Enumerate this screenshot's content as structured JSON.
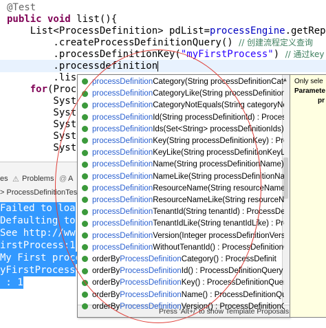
{
  "editor": {
    "lines": [
      {
        "parts": [
          {
            "t": "@Test",
            "c": "ann"
          }
        ]
      },
      {
        "parts": [
          {
            "t": "public void ",
            "c": "kw"
          },
          {
            "t": "list(){",
            "c": "fn"
          }
        ]
      },
      {
        "parts": [
          {
            "t": "    List<ProcessDefinition> pdList=",
            "c": "fn"
          },
          {
            "t": "processEngine",
            "c": "field"
          },
          {
            "t": ".getRepos",
            "c": "fn"
          }
        ]
      },
      {
        "parts": [
          {
            "t": "        .createProcessDefinitionQuery() ",
            "c": "fn"
          },
          {
            "t": "// 创建流程定义查询",
            "c": "cmt"
          }
        ]
      },
      {
        "parts": [
          {
            "t": "        .processDefinitionKey(",
            "c": "fn"
          },
          {
            "t": "\"myFirstProcess\"",
            "c": "str"
          },
          {
            "t": ") ",
            "c": "fn"
          },
          {
            "t": "// 通过key",
            "c": "cmt"
          }
        ]
      },
      {
        "parts": [
          {
            "t": "        .processdefinition",
            "c": "fn"
          }
        ]
      },
      {
        "parts": [
          {
            "t": "        .lis",
            "c": "fn"
          }
        ]
      },
      {
        "parts": [
          {
            "t": "    ",
            "c": "fn"
          },
          {
            "t": "for",
            "c": "kw"
          },
          {
            "t": "(Proc",
            "c": "fn"
          }
        ]
      },
      {
        "parts": [
          {
            "t": "        Syst",
            "c": "fn"
          }
        ]
      },
      {
        "parts": [
          {
            "t": "        Syst",
            "c": "fn"
          }
        ]
      },
      {
        "parts": [
          {
            "t": "        Syst",
            "c": "fn"
          }
        ]
      },
      {
        "parts": [
          {
            "t": "        Syst",
            "c": "fn"
          }
        ]
      },
      {
        "parts": [
          {
            "t": "        Syst",
            "c": "fn"
          }
        ]
      }
    ]
  },
  "bottom_panel": {
    "tabs": [
      "es",
      "Problems",
      "A"
    ],
    "test_label": "> ProcessDefinitionTes",
    "console_lines": [
      "Failed to loa",
      "Defaulting to",
      "See http://ww",
      "irstProcess:1",
      "My First proce",
      "yFirstProcess",
      " : 1"
    ]
  },
  "popup": {
    "items": [
      {
        "hl": "processDefinition",
        "rest": "Category(String processDefinitionCatego",
        "static": false
      },
      {
        "hl": "processDefinition",
        "rest": "CategoryLike(String processDefinitionCa",
        "static": false
      },
      {
        "hl": "processDefinition",
        "rest": "CategoryNotEquals(String categoryNotE",
        "static": false
      },
      {
        "hl": "processDefinition",
        "rest": "Id(String processDefinitionId) : Process",
        "static": false
      },
      {
        "hl": "processDefinition",
        "rest": "Ids(Set<String> processDefinitionIds) : P",
        "static": false
      },
      {
        "hl": "processDefinition",
        "rest": "Key(String processDefinitionKey) : Proce",
        "static": false
      },
      {
        "hl": "processDefinition",
        "rest": "KeyLike(String processDefinitionKeyLike)",
        "static": false
      },
      {
        "hl": "processDefinition",
        "rest": "Name(String processDefinitionName) : P",
        "static": false
      },
      {
        "hl": "processDefinition",
        "rest": "NameLike(String processDefinitionNameL",
        "static": false
      },
      {
        "hl": "processDefinition",
        "rest": "ResourceName(String resourceName) : P",
        "static": false
      },
      {
        "hl": "processDefinition",
        "rest": "ResourceNameLike(String resourceNameLik",
        "static": false
      },
      {
        "hl": "processDefinition",
        "rest": "TenantId(String tenantId) : ProcessDefin",
        "static": false
      },
      {
        "hl": "processDefinition",
        "rest": "TenantIdLike(String tenantIdLike) : Proce",
        "static": false
      },
      {
        "hl": "processDefinition",
        "rest": "Version(Integer processDefinitionVersio",
        "static": false
      },
      {
        "hl": "processDefinition",
        "rest": "WithoutTenantId() : ProcessDefinitionQu",
        "static": false
      },
      {
        "pre": "orderBy",
        "hl": "ProcessDefinition",
        "rest": "Category() : ProcessDefinit",
        "static": false
      },
      {
        "pre": "orderBy",
        "hl": "ProcessDefinition",
        "rest": "Id() : ProcessDefinitionQuery - P",
        "static": false
      },
      {
        "pre": "orderBy",
        "hl": "ProcessDefinition",
        "rest": "Key() : ProcessDefinitionQuery - P",
        "static": false
      },
      {
        "pre": "orderBy",
        "hl": "ProcessDefinition",
        "rest": "Name() : ProcessDefinitionQuery -",
        "static": false
      },
      {
        "pre": "orderBy",
        "hl": "ProcessDefinition",
        "rest": "Version() : ProcessDefinitionQue",
        "static": false
      }
    ],
    "footer": "Press 'Alt+/' to show Template Proposals"
  },
  "docpane": {
    "line1": "Only sele",
    "line2": "Paramete",
    "line3": "pr"
  }
}
